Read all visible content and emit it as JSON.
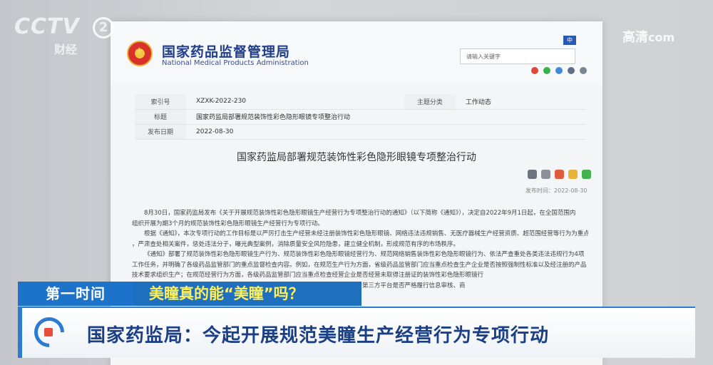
{
  "broadcast": {
    "channel_logo": "CCTV",
    "channel_number": "2",
    "channel_name": "财经",
    "hd_label": "高清",
    "hd_domain": "com"
  },
  "site": {
    "name_cn": "国家药品监督管理局",
    "name_en": "National Medical Products Administration",
    "search_placeholder": "请输入关键字",
    "lang": "中"
  },
  "info_table": [
    {
      "k1": "索引号",
      "v1": "XZXK-2022-230",
      "k2": "主题分类",
      "v2": "工作动态"
    },
    {
      "k1": "标题",
      "v1": "国家药监局部署规范装饰性彩色隐形眼镜专项整治行动",
      "k2": "",
      "v2": ""
    },
    {
      "k1": "发布日期",
      "v1": "2022-08-30",
      "k2": "",
      "v2": ""
    }
  ],
  "doc_title": "国家药监局部署规范装饰性彩色隐形眼镜专项整治行动",
  "pub_date": "发布时间：2022-08-30",
  "body": [
    "8月30日，国家药监局发布《关于开展规范装饰性彩色隐形眼镜生产经营行为专项整治行动的通知》（以下简称《通知》），决定自2022年9月1日起，在全国范围内",
    "组织开展为期3个月的规范装饰性彩色隐形眼镜生产经营行为专项行动。",
    "根据《通知》，本次专项行动的工作目标是以严厉打击生产经营未经注册装饰性彩色隐形眼镜、网络违法违规销售、无医疗器械生产经营资质、超范围经营等行为为重点",
    "，严肃查处相关案件，惩处违法分子，曝光典型案例，消除质量安全风险隐患，建立健全机制，形成规范有序的市场秩序。",
    "《通知》部署了规范装饰性彩色隐形眼镜生产行为、规范装饰性彩色隐形眼镜经营行为、规范网络销售装饰性彩色隐形眼镜行为、依法严查重处各类违法违规行为4项",
    "工作任务，并明确了各级药品监管部门的重点监督检查内容。例如，在规范生产行为方面，省级药品监管部门应当重点检查生产企业是否按照强制性标准以及经注册的产品",
    "技术要求组织生产；在规范经营行为方面，各级药品监管部门应当重点检查经营企业是否经营未取得注册证的装饰性彩色隐形眼镜行",
    "为；在规范网络销售行为方面，省级药品监管部门应当重点检查医疗器械网络交易服务第三方平台是否严格履行信息审核、商"
  ],
  "lower_third": {
    "tag": "第一时间",
    "question": "美瞳真的能“美瞳”吗？",
    "headline": "国家药监局：今起开展规范美瞳生产经营行为专项行动"
  },
  "colors": {
    "brand_blue": "#1d72c9",
    "headline_blue": "#1b3f86",
    "question_yellow": "#fff05a"
  }
}
